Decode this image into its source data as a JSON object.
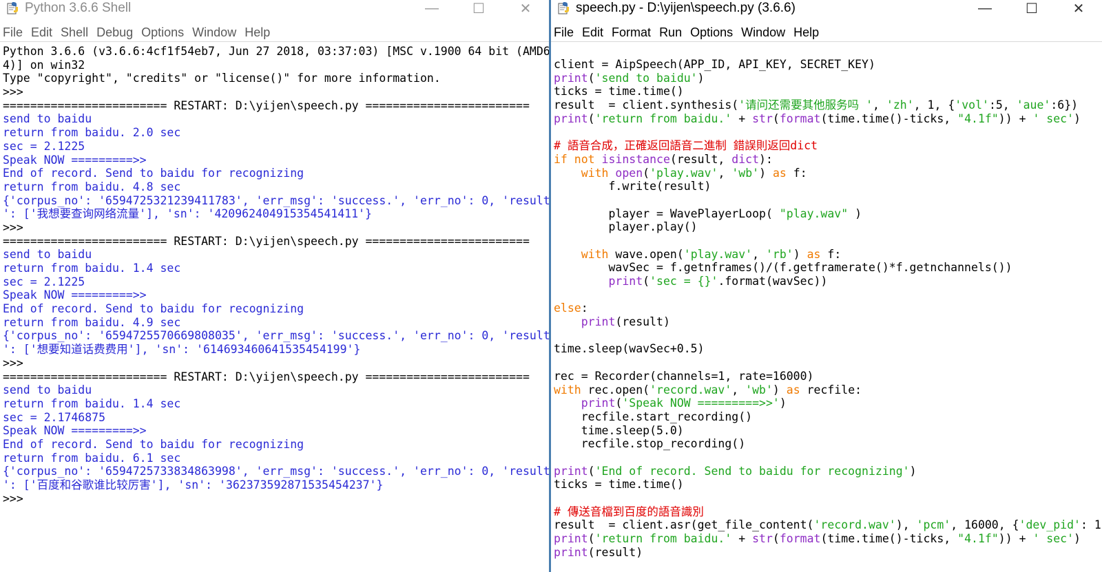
{
  "shell": {
    "title": "Python 3.6.6 Shell",
    "controls": [
      "—",
      "☐",
      "✕"
    ],
    "menu": [
      "File",
      "Edit",
      "Shell",
      "Debug",
      "Options",
      "Window",
      "Help"
    ],
    "lines": [
      "Python 3.6.6 (v3.6.6:4cf1f54eb7, Jun 27 2018, 03:37:03) [MSC v.1900 64 bit (AMD6",
      "4)] on win32",
      "Type \"copyright\", \"credits\" or \"license()\" for more information.",
      ">>> ",
      "======================== RESTART: D:\\yijen\\speech.py ========================",
      "send to baidu",
      "return from baidu. 2.0 sec",
      "sec = 2.1225",
      "Speak NOW =========>>",
      "End of record. Send to baidu for recognizing",
      "return from baidu. 4.8 sec",
      "{'corpus_no': '6594725321239411783', 'err_msg': 'success.', 'err_no': 0, 'result",
      "': ['我想要查询网络流量'], 'sn': '420962404915354541411'}",
      ">>> ",
      "======================== RESTART: D:\\yijen\\speech.py ========================",
      "send to baidu",
      "return from baidu. 1.4 sec",
      "sec = 2.1225",
      "Speak NOW =========>>",
      "End of record. Send to baidu for recognizing",
      "return from baidu. 4.9 sec",
      "{'corpus_no': '6594725570669808035', 'err_msg': 'success.', 'err_no': 0, 'result",
      "': ['想要知道话费费用'], 'sn': '614693460641535454199'}",
      ">>> ",
      "======================== RESTART: D:\\yijen\\speech.py ========================",
      "send to baidu",
      "return from baidu. 1.4 sec",
      "sec = 2.1746875",
      "Speak NOW =========>>",
      "End of record. Send to baidu for recognizing",
      "return from baidu. 6.1 sec",
      "{'corpus_no': '6594725733834863998', 'err_msg': 'success.', 'err_no': 0, 'result",
      "': ['百度和谷歌谁比较厉害'], 'sn': '362373592871535454237'}",
      ">>> "
    ],
    "line_colors": [
      "k",
      "k",
      "k",
      "k",
      "k",
      "b",
      "b",
      "b",
      "b",
      "b",
      "b",
      "b",
      "b",
      "k",
      "k",
      "b",
      "b",
      "b",
      "b",
      "b",
      "b",
      "b",
      "b",
      "k",
      "k",
      "b",
      "b",
      "b",
      "b",
      "b",
      "b",
      "b",
      "b",
      "k"
    ]
  },
  "editor": {
    "title": "speech.py - D:\\yijen\\speech.py (3.6.6)",
    "controls": [
      "—",
      "☐",
      "✕"
    ],
    "menu": [
      "File",
      "Edit",
      "Format",
      "Run",
      "Options",
      "Window",
      "Help"
    ],
    "code": [
      [
        [
          "k",
          "client = AipSpeech(APP_ID, API_KEY, SECRET_KEY)"
        ]
      ],
      [
        [
          "bi",
          "print"
        ],
        [
          "k",
          "("
        ],
        [
          "str",
          "'send to baidu'"
        ],
        [
          "k",
          ")"
        ]
      ],
      [
        [
          "k",
          "ticks = time.time()"
        ]
      ],
      [
        [
          "k",
          "result  = client.synthesis("
        ],
        [
          "str",
          "'请问还需要其他服务吗 '"
        ],
        [
          "k",
          ", "
        ],
        [
          "str",
          "'zh'"
        ],
        [
          "k",
          ", 1, {"
        ],
        [
          "str",
          "'vol'"
        ],
        [
          "k",
          ":5, "
        ],
        [
          "str",
          "'aue'"
        ],
        [
          "k",
          ":6})"
        ]
      ],
      [
        [
          "bi",
          "print"
        ],
        [
          "k",
          "("
        ],
        [
          "str",
          "'return from baidu.'"
        ],
        [
          "k",
          " + "
        ],
        [
          "bi",
          "str"
        ],
        [
          "k",
          "("
        ],
        [
          "bi",
          "format"
        ],
        [
          "k",
          "(time.time()-ticks, "
        ],
        [
          "str",
          "\"4.1f\""
        ],
        [
          "k",
          ")) + "
        ],
        [
          "str",
          "' sec'"
        ],
        [
          "k",
          ")"
        ]
      ],
      [
        [
          "k",
          ""
        ]
      ],
      [
        [
          "cm",
          "# 語音合成，正確返回語音二進制 錯誤則返回dict"
        ]
      ],
      [
        [
          "kw",
          "if not "
        ],
        [
          "bi",
          "isinstance"
        ],
        [
          "k",
          "(result, "
        ],
        [
          "bi",
          "dict"
        ],
        [
          "k",
          "):"
        ]
      ],
      [
        [
          "k",
          "    "
        ],
        [
          "kw",
          "with "
        ],
        [
          "bi",
          "open"
        ],
        [
          "k",
          "("
        ],
        [
          "str",
          "'play.wav'"
        ],
        [
          "k",
          ", "
        ],
        [
          "str",
          "'wb'"
        ],
        [
          "k",
          ") "
        ],
        [
          "kw",
          "as"
        ],
        [
          "k",
          " f:"
        ]
      ],
      [
        [
          "k",
          "        f.write(result)"
        ]
      ],
      [
        [
          "k",
          ""
        ]
      ],
      [
        [
          "k",
          "        player = WavePlayerLoop( "
        ],
        [
          "str",
          "\"play.wav\""
        ],
        [
          "k",
          " )"
        ]
      ],
      [
        [
          "k",
          "        player.play()"
        ]
      ],
      [
        [
          "k",
          ""
        ]
      ],
      [
        [
          "k",
          "    "
        ],
        [
          "kw",
          "with "
        ],
        [
          "k",
          "wave.open("
        ],
        [
          "str",
          "'play.wav'"
        ],
        [
          "k",
          ", "
        ],
        [
          "str",
          "'rb'"
        ],
        [
          "k",
          ") "
        ],
        [
          "kw",
          "as"
        ],
        [
          "k",
          " f:"
        ]
      ],
      [
        [
          "k",
          "        wavSec = f.getnframes()/(f.getframerate()*f.getnchannels())"
        ]
      ],
      [
        [
          "k",
          "        "
        ],
        [
          "bi",
          "print"
        ],
        [
          "k",
          "("
        ],
        [
          "str",
          "'sec = {}'"
        ],
        [
          "k",
          ".format(wavSec))"
        ]
      ],
      [
        [
          "k",
          ""
        ]
      ],
      [
        [
          "kw",
          "else"
        ],
        [
          "k",
          ":"
        ]
      ],
      [
        [
          "k",
          "    "
        ],
        [
          "bi",
          "print"
        ],
        [
          "k",
          "(result)"
        ]
      ],
      [
        [
          "k",
          ""
        ]
      ],
      [
        [
          "k",
          "time.sleep(wavSec+0.5)"
        ]
      ],
      [
        [
          "k",
          ""
        ]
      ],
      [
        [
          "k",
          "rec = Recorder(channels=1, rate=16000)"
        ]
      ],
      [
        [
          "kw",
          "with "
        ],
        [
          "k",
          "rec.open("
        ],
        [
          "str",
          "'record.wav'"
        ],
        [
          "k",
          ", "
        ],
        [
          "str",
          "'wb'"
        ],
        [
          "k",
          ") "
        ],
        [
          "kw",
          "as"
        ],
        [
          "k",
          " recfile:"
        ]
      ],
      [
        [
          "k",
          "    "
        ],
        [
          "bi",
          "print"
        ],
        [
          "k",
          "("
        ],
        [
          "str",
          "'Speak NOW =========>>'"
        ],
        [
          "k",
          ")"
        ]
      ],
      [
        [
          "k",
          "    recfile.start_recording()"
        ]
      ],
      [
        [
          "k",
          "    time.sleep(5.0)"
        ]
      ],
      [
        [
          "k",
          "    recfile.stop_recording()"
        ]
      ],
      [
        [
          "k",
          ""
        ]
      ],
      [
        [
          "bi",
          "print"
        ],
        [
          "k",
          "("
        ],
        [
          "str",
          "'End of record. Send to baidu for recognizing'"
        ],
        [
          "k",
          ")"
        ]
      ],
      [
        [
          "k",
          "ticks = time.time()"
        ]
      ],
      [
        [
          "k",
          ""
        ]
      ],
      [
        [
          "cm",
          "# 傳送音檔到百度的語音識別"
        ]
      ],
      [
        [
          "k",
          "result  = client.asr(get_file_content("
        ],
        [
          "str",
          "'record.wav'"
        ],
        [
          "k",
          "), "
        ],
        [
          "str",
          "'pcm'"
        ],
        [
          "k",
          ", 16000, {"
        ],
        [
          "str",
          "'dev_pid'"
        ],
        [
          "k",
          ": 1"
        ]
      ],
      [
        [
          "bi",
          "print"
        ],
        [
          "k",
          "("
        ],
        [
          "str",
          "'return from baidu.'"
        ],
        [
          "k",
          " + "
        ],
        [
          "bi",
          "str"
        ],
        [
          "k",
          "("
        ],
        [
          "bi",
          "format"
        ],
        [
          "k",
          "(time.time()-ticks, "
        ],
        [
          "str",
          "\"4.1f\""
        ],
        [
          "k",
          ")) + "
        ],
        [
          "str",
          "' sec'"
        ],
        [
          "k",
          ")"
        ]
      ],
      [
        [
          "bi",
          "print"
        ],
        [
          "k",
          "(result)"
        ]
      ]
    ]
  },
  "colors": {
    "shell_output": "#2a2ad6",
    "string": "#1fa51f",
    "builtin": "#8e2cc4",
    "keyword": "#f07a00",
    "comment": "#e00000",
    "window_divider": "#4a7fb0"
  }
}
